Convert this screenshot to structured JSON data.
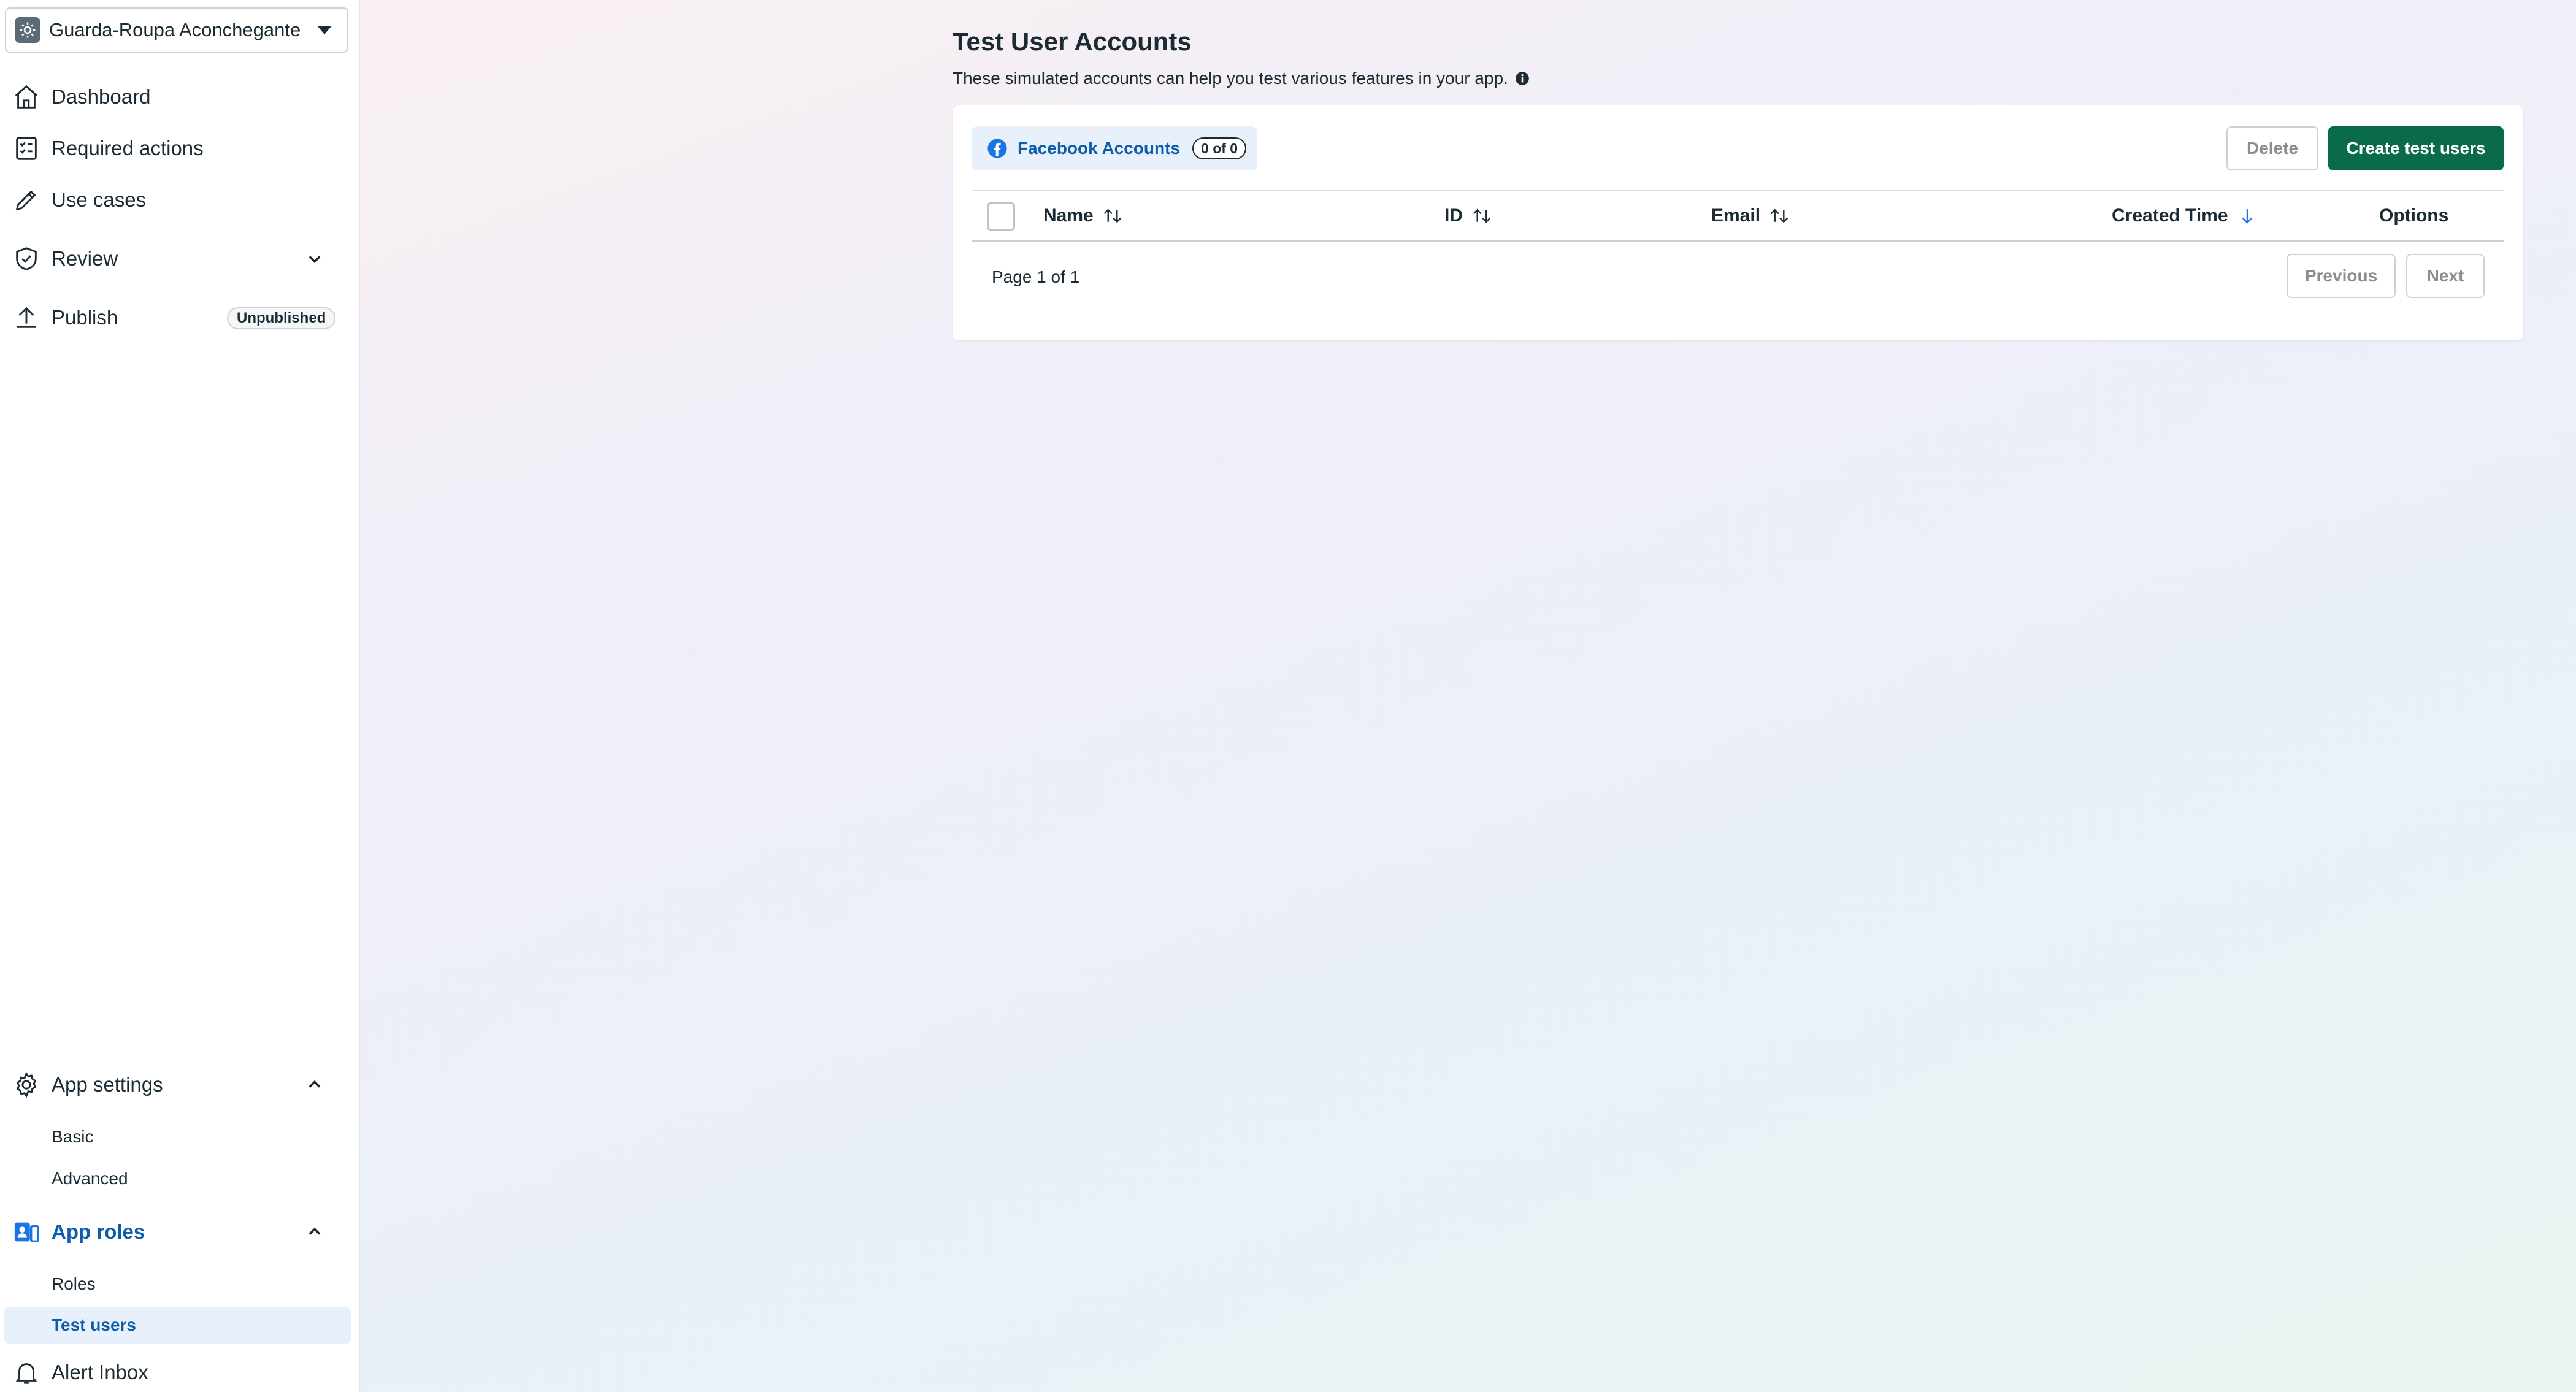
{
  "sidebar": {
    "app_selector": {
      "name": "Guarda-Roupa Aconchegante",
      "icon": "gear-app-icon"
    },
    "nav": [
      {
        "label": "Dashboard",
        "icon": "home-icon"
      },
      {
        "label": "Required actions",
        "icon": "checklist-icon"
      },
      {
        "label": "Use cases",
        "icon": "pencil-icon"
      },
      {
        "label": "Review",
        "icon": "shield-check-icon"
      },
      {
        "label": "Publish",
        "icon": "upload-icon",
        "badge": "Unpublished"
      }
    ],
    "app_settings": {
      "label": "App settings",
      "icon": "gear-icon",
      "items": [
        {
          "label": "Basic"
        },
        {
          "label": "Advanced"
        }
      ]
    },
    "app_roles": {
      "label": "App roles",
      "icon": "app-roles-icon",
      "items": [
        {
          "label": "Roles"
        },
        {
          "label": "Test users",
          "active": true
        }
      ]
    },
    "alert_inbox": {
      "label": "Alert Inbox",
      "icon": "bell-icon"
    }
  },
  "main": {
    "title": "Test User Accounts",
    "subtitle": "These simulated accounts can help you test various features in your app.",
    "tab": {
      "label": "Facebook Accounts",
      "count": "0 of 0",
      "icon": "facebook-icon"
    },
    "buttons": {
      "delete": "Delete",
      "create": "Create test users"
    },
    "table": {
      "columns": [
        {
          "label": "Name",
          "sort": "both"
        },
        {
          "label": "ID",
          "sort": "both"
        },
        {
          "label": "Email",
          "sort": "both"
        },
        {
          "label": "Created Time",
          "sort": "desc"
        },
        {
          "label": "Options",
          "sort": "none"
        }
      ],
      "rows": []
    },
    "pagination": {
      "text": "Page 1 of 1",
      "previous": "Previous",
      "next": "Next"
    }
  },
  "colors": {
    "accent_blue": "#0d5dab",
    "primary_green": "#0a6b4a",
    "active_bg": "#e7f0fb"
  }
}
